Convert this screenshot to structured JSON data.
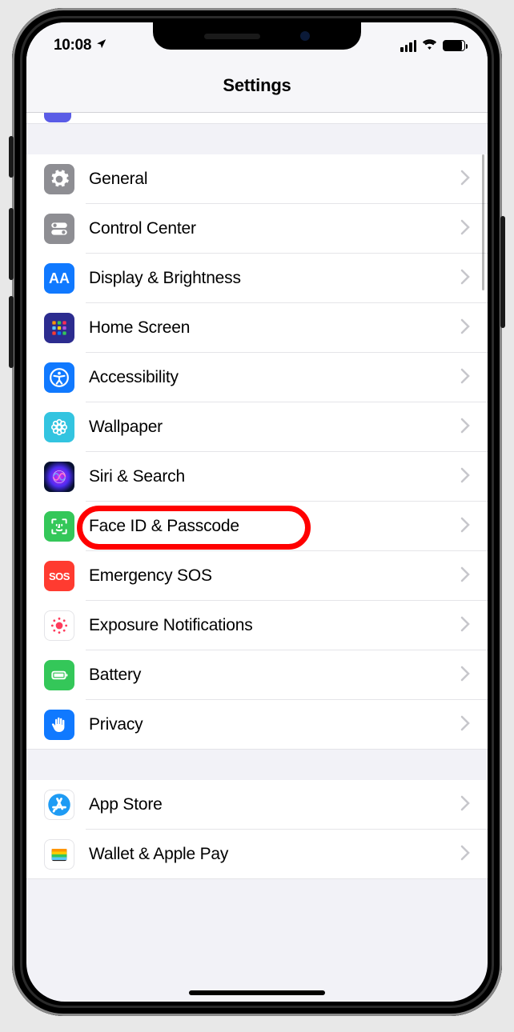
{
  "status": {
    "time": "10:08"
  },
  "header": {
    "title": "Settings"
  },
  "groups": [
    {
      "items": [
        {
          "key": "general",
          "label": "General",
          "icon": "gear-icon"
        },
        {
          "key": "control_center",
          "label": "Control Center",
          "icon": "toggles-icon"
        },
        {
          "key": "display",
          "label": "Display & Brightness",
          "icon": "text-size-icon"
        },
        {
          "key": "home_screen",
          "label": "Home Screen",
          "icon": "grid-icon"
        },
        {
          "key": "accessibility",
          "label": "Accessibility",
          "icon": "accessibility-icon"
        },
        {
          "key": "wallpaper",
          "label": "Wallpaper",
          "icon": "flower-icon"
        },
        {
          "key": "siri",
          "label": "Siri & Search",
          "icon": "siri-icon"
        },
        {
          "key": "faceid",
          "label": "Face ID & Passcode",
          "icon": "faceid-icon"
        },
        {
          "key": "sos",
          "label": "Emergency SOS",
          "icon": "sos-icon"
        },
        {
          "key": "exposure",
          "label": "Exposure Notifications",
          "icon": "exposure-icon"
        },
        {
          "key": "battery",
          "label": "Battery",
          "icon": "battery-icon"
        },
        {
          "key": "privacy",
          "label": "Privacy",
          "icon": "hand-icon"
        }
      ]
    },
    {
      "items": [
        {
          "key": "appstore",
          "label": "App Store",
          "icon": "appstore-icon"
        },
        {
          "key": "wallet",
          "label": "Wallet & Apple Pay",
          "icon": "wallet-icon"
        }
      ]
    }
  ],
  "sos_text": "SOS",
  "display_text": "AA",
  "annotation": {
    "highlighted_item": "siri"
  }
}
